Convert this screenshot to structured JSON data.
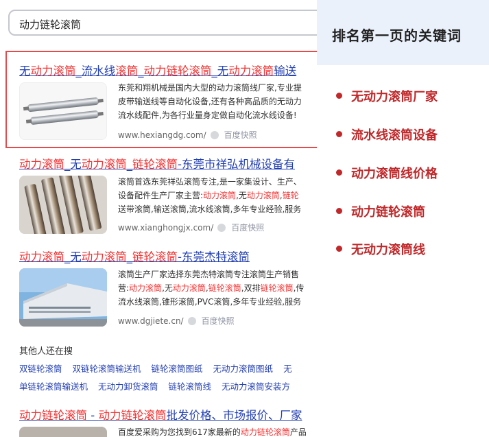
{
  "search": {
    "query": "动力链轮滚筒"
  },
  "results": [
    {
      "title_parts": [
        {
          "t": "无",
          "hl": false
        },
        {
          "t": "动力滚筒",
          "hl": true
        },
        {
          "t": "_流水线",
          "hl": false
        },
        {
          "t": "滚筒",
          "hl": true
        },
        {
          "t": "_",
          "hl": false
        },
        {
          "t": "动力链轮滚筒",
          "hl": true
        },
        {
          "t": "_无",
          "hl": false
        },
        {
          "t": "动力滚筒",
          "hl": true
        },
        {
          "t": "输送",
          "hl": false
        }
      ],
      "snippet_lines": [
        [
          {
            "t": "东莞和翔机械是国内大型的动力滚筒线厂家,专业提",
            "hl": false
          }
        ],
        [
          {
            "t": "皮带输送线等自动化设备,还有各种高品质的无动力",
            "hl": false
          }
        ],
        [
          {
            "t": "流水线配件,为各行业量身定做自动化流水线设备!",
            "hl": false
          }
        ]
      ],
      "url": "www.hexiangdg.com/",
      "snapshot": "百度快照"
    },
    {
      "title_parts": [
        {
          "t": "动力滚筒",
          "hl": true
        },
        {
          "t": "_无",
          "hl": false
        },
        {
          "t": "动力滚筒",
          "hl": true
        },
        {
          "t": "_",
          "hl": false
        },
        {
          "t": "链轮滚筒",
          "hl": true
        },
        {
          "t": "-东莞市祥弘机械设备有",
          "hl": false
        }
      ],
      "snippet_lines": [
        [
          {
            "t": "滚筒首选东莞祥弘滚筒专注,是一家集设计、生产、",
            "hl": false
          }
        ],
        [
          {
            "t": "设备配件生产厂家主营:",
            "hl": false
          },
          {
            "t": "动力滚筒",
            "hl": true
          },
          {
            "t": ",无",
            "hl": false
          },
          {
            "t": "动力滚筒",
            "hl": true
          },
          {
            "t": ",",
            "hl": false
          },
          {
            "t": "链轮",
            "hl": true
          }
        ],
        [
          {
            "t": "送带滚筒,输送滚筒,流水线滚筒,多年专业经验,服务",
            "hl": false
          }
        ]
      ],
      "url": "www.xianghongjx.com/",
      "snapshot": "百度快照"
    },
    {
      "title_parts": [
        {
          "t": "动力滚筒",
          "hl": true
        },
        {
          "t": "_无",
          "hl": false
        },
        {
          "t": "动力滚筒",
          "hl": true
        },
        {
          "t": "_",
          "hl": false
        },
        {
          "t": "链轮滚筒",
          "hl": true
        },
        {
          "t": "-东莞杰特滚筒",
          "hl": false
        }
      ],
      "snippet_lines": [
        [
          {
            "t": "滚筒生产厂家选择东莞杰特滚筒专注滚筒生产销售",
            "hl": false
          }
        ],
        [
          {
            "t": "营:",
            "hl": false
          },
          {
            "t": "动力滚筒",
            "hl": true
          },
          {
            "t": ",无",
            "hl": false
          },
          {
            "t": "动力滚筒",
            "hl": true
          },
          {
            "t": ",",
            "hl": false
          },
          {
            "t": "链轮滚筒",
            "hl": true
          },
          {
            "t": ",双排",
            "hl": false
          },
          {
            "t": "链轮滚筒",
            "hl": true
          },
          {
            "t": ",传",
            "hl": false
          }
        ],
        [
          {
            "t": "流水线滚筒,锥形滚筒,PVC滚筒,多年专业经验,服务",
            "hl": false
          }
        ]
      ],
      "url": "www.dgjiete.cn/",
      "snapshot": "百度快照"
    }
  ],
  "others": {
    "title": "其他人还在搜",
    "row1": [
      "双链轮滚筒",
      "双链轮滚筒输送机",
      "链轮滚筒图纸",
      "无动力滚筒图纸",
      "无"
    ],
    "row2": [
      "单链轮滚筒输送机",
      "无动力卸货滚筒",
      "链轮滚筒线",
      "无动力滚筒安装方"
    ]
  },
  "bottom_result": {
    "title_parts": [
      {
        "t": "动力链轮滚筒",
        "hl": true
      },
      {
        "t": " - ",
        "hl": false
      },
      {
        "t": "动力链轮滚筒",
        "hl": true
      },
      {
        "t": "批发价格、市场报价、厂家",
        "hl": false
      }
    ],
    "snippet_parts": [
      {
        "t": "百度爱采购为您找到617家最新的",
        "hl": false
      },
      {
        "t": "动力链轮滚筒",
        "hl": true
      },
      {
        "t": "产品",
        "hl": false
      }
    ]
  },
  "panel": {
    "title": "排名第一页的关键词",
    "keywords": [
      "无动力滚筒厂家",
      "流水线滚筒设备",
      "动力滚筒线价格",
      "动力链轮滚筒",
      "无动力滚筒线"
    ]
  },
  "colors": {
    "link": "#2440b3",
    "highlight": "#f73131",
    "keyword": "#c0282a",
    "frame": "#e64b4b",
    "panel_bg": "#eaf1fb"
  }
}
